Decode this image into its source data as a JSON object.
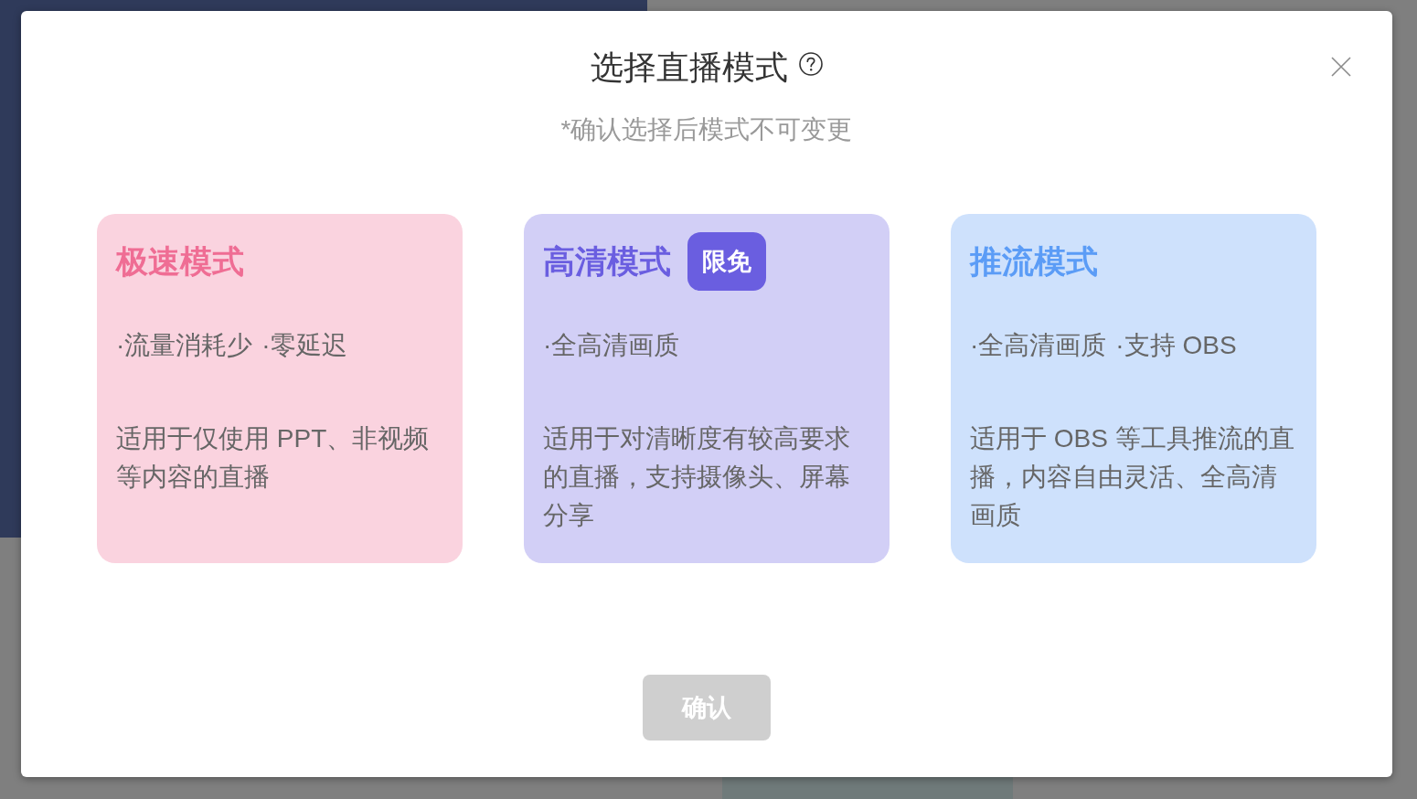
{
  "dialog": {
    "title": "选择直播模式",
    "subtitle": "*确认选择后模式不可变更",
    "modes": [
      {
        "name": "极速模式",
        "color": "#ef6d94",
        "selected": false,
        "features": [
          "·流量消耗少",
          "·零延迟"
        ],
        "description": "适用于仅使用 PPT、非视频等内容的直播"
      },
      {
        "name": "高清模式",
        "color": "#6a5ee0",
        "selected": false,
        "badge": "限免",
        "features": [
          "·全高清画质"
        ],
        "description": "适用于对清晰度有较高要求的直播，支持摄像头、屏幕分享"
      },
      {
        "name": "推流模式",
        "color": "#5b9cf6",
        "selected": false,
        "features": [
          "·全高清画质",
          "·支持 OBS"
        ],
        "description": "适用于 OBS 等工具推流的直播，内容自由灵活、全高清画质"
      }
    ],
    "confirm_button": {
      "label": "确认",
      "disabled": true
    }
  }
}
